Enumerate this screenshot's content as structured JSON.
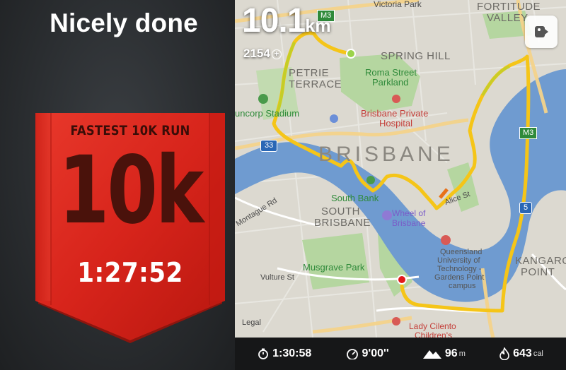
{
  "celebration": {
    "headline": "Nicely done",
    "badge": {
      "caption": "FASTEST 10K RUN",
      "big_text": "10k",
      "time": "1:27:52",
      "color": "#d7241b"
    }
  },
  "map": {
    "distance_value": "10.1",
    "distance_unit": "km",
    "steps": "2154",
    "steps_icon": "plus-circle-icon",
    "share_icon": "share-icon",
    "route_color": "#f5c518",
    "water_color": "#6f9bd0",
    "park_color": "#b5d6a0",
    "labels": {
      "victoria_park": "Victoria Park",
      "fortitude_valley_1": "FORTITUDE",
      "fortitude_valley_2": "VALLEY",
      "spring_hill": "SPRING HILL",
      "petrie_terrace_1": "PETRIE",
      "petrie_terrace_2": "TERRACE",
      "roma_street_1": "Roma Street",
      "roma_street_2": "Parkland",
      "suncorp": "uncorp Stadium",
      "hospital_1": "Brisbane Private",
      "hospital_2": "Hospital",
      "brisbane": "BRISBANE",
      "south_bank": "South Bank",
      "south_brisbane_1": "SOUTH",
      "south_brisbane_2": "BRISBANE",
      "wheel_1": "Wheel of",
      "wheel_2": "Brisbane",
      "montague": "Montague Rd",
      "alice_st": "Alice St",
      "qut_1": "Queensland",
      "qut_2": "University of",
      "qut_3": "Technology -",
      "qut_4": "Gardens Point",
      "qut_5": "campus",
      "musgrave": "Musgrave Park",
      "vulture": "Vulture St",
      "kangaroo_1": "KANGAROO",
      "kangaroo_2": "POINT",
      "lady_cilento_1": "Lady Cilento",
      "lady_cilento_2": "Children's",
      "shield_m3": "M3",
      "shield_33": "33",
      "shield_m3b": "M3",
      "shield_5": "5",
      "legal": "Legal"
    }
  },
  "stats": [
    {
      "icon": "stopwatch-icon",
      "value": "1:30:58",
      "unit": ""
    },
    {
      "icon": "pace-gauge-icon",
      "value": "9'00''",
      "unit": ""
    },
    {
      "icon": "elevation-icon",
      "value": "96",
      "unit": "m"
    },
    {
      "icon": "flame-icon",
      "value": "643",
      "unit": "cal"
    }
  ]
}
